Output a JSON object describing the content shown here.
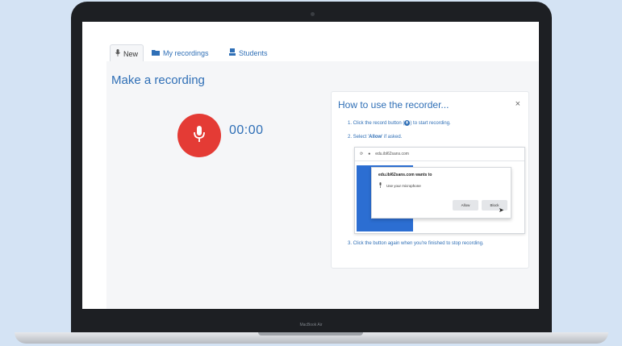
{
  "tabs": [
    {
      "label": "New",
      "icon": "microphone-icon",
      "active": true
    },
    {
      "label": "My recordings",
      "icon": "folder-icon",
      "active": false
    },
    {
      "label": "Students",
      "icon": "student-icon",
      "active": false
    }
  ],
  "main": {
    "title": "Make a recording",
    "timer": "00:00"
  },
  "help": {
    "title": "How to use the recorder...",
    "close": "×",
    "step1_a": "1. Click the record button (",
    "step1_b": ") to start recording.",
    "step2_a": "2. Select '",
    "step2_allow": "Allow",
    "step2_b": "' if asked.",
    "step3": "3. Click the button again when you're finished to stop recording."
  },
  "browser_prompt": {
    "url": "edu.ibl62sans.com",
    "dialog_title": "edu.ibl62sans.com wants to",
    "permission": "Use your microphone",
    "allow": "Allow",
    "block": "Block"
  },
  "device": {
    "model": "MacBook Air"
  },
  "colors": {
    "accent": "#2f6fb6",
    "record": "#e43b35",
    "background": "#d4e3f4"
  }
}
